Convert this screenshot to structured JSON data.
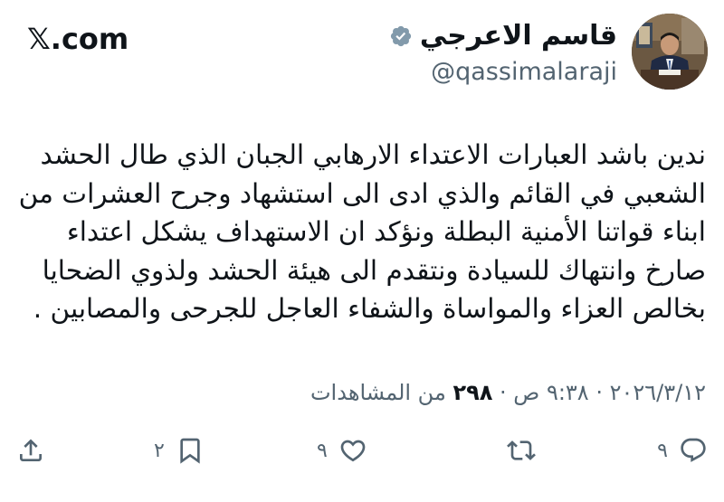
{
  "header": {
    "brand": "𝕏.com",
    "display_name": "قاسم الاعرجي",
    "handle": "@qassimalaraji",
    "verified_color": "#829aab"
  },
  "tweet": {
    "lines": [
      "ندين باشد العبارات الاعتداء الارهابي الجبان الذي طال الحشد",
      "الشعبي في القائم والذي ادى الى استشهاد وجرح العشرات من",
      "ابناء قواتنا الأمنية البطلة ونؤكد ان الاستهداف يشكل اعتداء",
      "صارخ وانتهاك للسيادة ونتقدم الى هيئة الحشد ولذوي الضحايا",
      "بخالص العزاء والمواساة والشفاء العاجل للجرحى والمصابين ."
    ]
  },
  "meta": {
    "time": "٩:٣٨ ص",
    "separator1": " · ",
    "date": "٢٠٢٦/٣/١٢",
    "separator2": " · ",
    "views_count": "٢٩٨",
    "views_label": " من المشاهدات"
  },
  "actions": {
    "reply_count": "٩",
    "repost_count": "",
    "like_count": "٩",
    "bookmark_count": "٢"
  },
  "colors": {
    "text": "#0f1419",
    "secondary": "#536471"
  }
}
